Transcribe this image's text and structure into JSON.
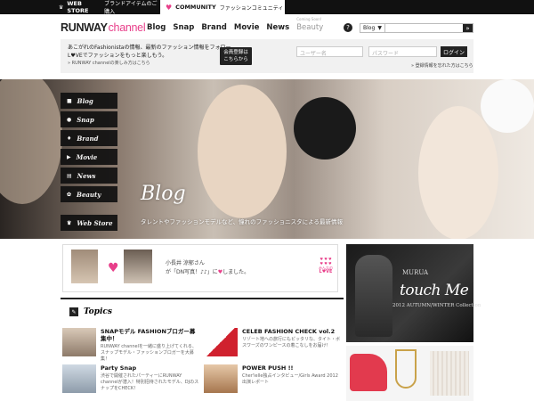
{
  "topbar": {
    "store_label": "WEB STORE",
    "store_text": "ブランドアイテムのご購入",
    "community_label": "COMMUNITY",
    "community_text": "ファッションコミュニティ"
  },
  "header": {
    "logo_main": "RUNWAY",
    "logo_channel": "channel",
    "nav": [
      "Blog",
      "Snap",
      "Brand",
      "Movie",
      "News"
    ],
    "nav_beauty": "Beauty",
    "nav_beauty_small": "Coming Soon!",
    "help": "?",
    "search_select": "Blog",
    "search_select_arrow": "▼",
    "search_button": "»"
  },
  "login": {
    "intro_line1": "あこがれのFashionistaの情報、最新のファッション情報をフォロー。",
    "intro_line2": "L♥VEでファッションをもっと楽しもう。",
    "intro_sub": "» RUNWAY channelの楽しみ方はこちら",
    "register_line1": "会員登録は",
    "register_line2": "こちらから",
    "user_placeholder": "ユーザー名",
    "password_placeholder": "パスワード",
    "login_button": "ログイン",
    "forgot": "» 登録情報を忘れた方はこちら"
  },
  "hero": {
    "title": "Blog",
    "subtitle": "タレントやファッションモデルなど、憧れのファッショニスタによる最新情報"
  },
  "side_menu": [
    {
      "icon": "■",
      "label": "Blog"
    },
    {
      "icon": "●",
      "label": "Snap"
    },
    {
      "icon": "♦",
      "label": "Brand"
    },
    {
      "icon": "▶",
      "label": "Movie"
    },
    {
      "icon": "▤",
      "label": "News"
    },
    {
      "icon": "✿",
      "label": "Beauty"
    },
    {
      "icon": "♛",
      "label": "Web Store"
    }
  ],
  "message": {
    "line1": "小長井 涼郁さん",
    "line2_pre": "が「DN写真！♪♪」に",
    "line2_heart": "♥",
    "line2_post": "しました。",
    "badge_hearts": "♥ ♥ ♥",
    "badge_line1": "みんなの",
    "badge_line2": "L♥VE"
  },
  "topics": {
    "heading": "Topics",
    "items": [
      {
        "title": "SNAPモデル FASHIONブロガー募集中！",
        "desc": "RUNWAY channelを一緒に盛り上げてくれる、スナップモデル・ファッションブロガーを大募集！"
      },
      {
        "title": "CELEB FASHION CHECK vol.2",
        "desc": "リゾート地への旅行にもピッタリな、タイト・ボスワーズのワンピースの着こなしをお届け！"
      },
      {
        "title": "Party Snap",
        "desc": "渋谷で開催されたパーティーにRUNWAY channelが潜入！特別招待されたモデル、DJのスナップをCHECK！"
      },
      {
        "title": "POWER PUSH !!",
        "desc": "Cher'ielle独占インタビュー/Girls Award 2012出演レポート"
      }
    ]
  },
  "ad": {
    "brand": "MURUA",
    "title": "touch Me",
    "collection": "2012 AUTUMN/WINTER Collection"
  },
  "colors": {
    "pink": "#e83f8a",
    "black": "#111111",
    "gray_bar": "#f1f1f1"
  }
}
